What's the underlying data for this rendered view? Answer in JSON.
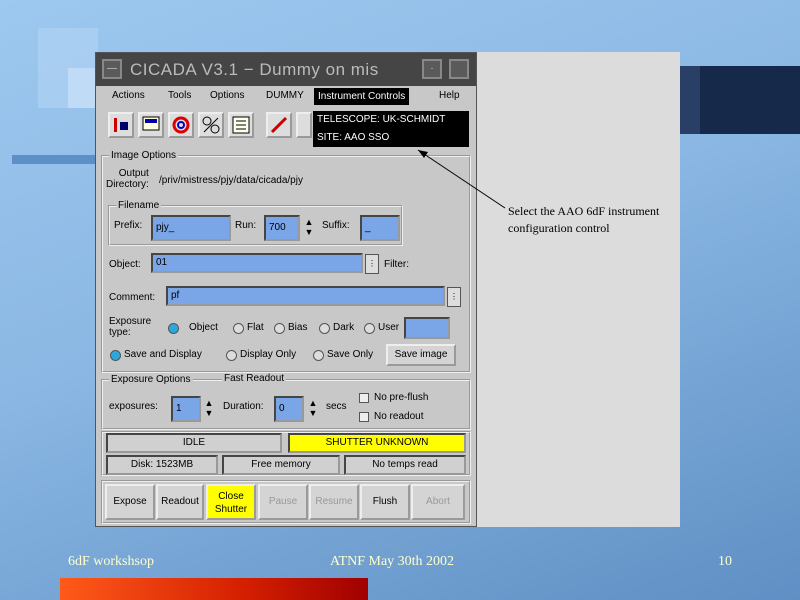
{
  "colors": {
    "field": "#7aa6e8",
    "shutter_bg": "#ffff00",
    "close_btn_bg": "#ffff00",
    "dropdown_bg": "#000000"
  },
  "window": {
    "title": "CICADA V3.1 − Dummy on mis",
    "menu": [
      "Actions",
      "Tools",
      "Options",
      "DUMMY",
      "Instrument Controls",
      "Help"
    ],
    "dropdown": [
      "TELESCOPE: UK-SCHMIDT",
      "SITE: AAO SSO"
    ],
    "toolbar_icons": [
      "io-icon",
      "monitor-icon",
      "ring-icon",
      "tools-icon",
      "list-icon",
      "pen-icon"
    ]
  },
  "image_options": {
    "label": "Image Options",
    "output_dir_label": "Output\nDirectory:",
    "output_dir": "/priv/mistress/pjy/data/cicada/pjy",
    "filename_label": "Filename",
    "prefix_label": "Prefix:",
    "prefix": "pjy_",
    "run_label": "Run:",
    "run": "700",
    "suffix_label": "Suffix:",
    "suffix": "_",
    "object_label": "Object:",
    "object": "01",
    "filter_label": "Filter:",
    "comment_label": "Comment:",
    "comment": "pf",
    "exposure_type_label": "Exposure\ntype:",
    "exposure_types": [
      "Object",
      "Flat",
      "Bias",
      "Dark",
      "User"
    ],
    "user_value": "",
    "save_modes": [
      "Save and Display",
      "Display Only",
      "Save Only"
    ],
    "save_image_button": "Save image"
  },
  "exposure_options": {
    "label": "Exposure Options",
    "fast_readout": "Fast Readout",
    "exposures_label": "exposures:",
    "exposures": "1",
    "duration_label": "Duration:",
    "duration": "0",
    "secs": "secs",
    "no_preflush": "No pre-flush",
    "no_readout": "No readout"
  },
  "status": {
    "state": "IDLE",
    "shutter": "SHUTTER UNKNOWN",
    "disk": "Disk: 1523MB",
    "memory": "Free memory",
    "temps": "No temps read"
  },
  "actions": [
    "Expose",
    "Readout",
    "Close\nShutter",
    "Pause",
    "Resume",
    "Flush",
    "Abort"
  ],
  "caption": "Select the AAO 6dF instrument configuration control",
  "footer": {
    "left": "6dF workshsop",
    "center": "ATNF May 30th 2002",
    "right": "10"
  }
}
